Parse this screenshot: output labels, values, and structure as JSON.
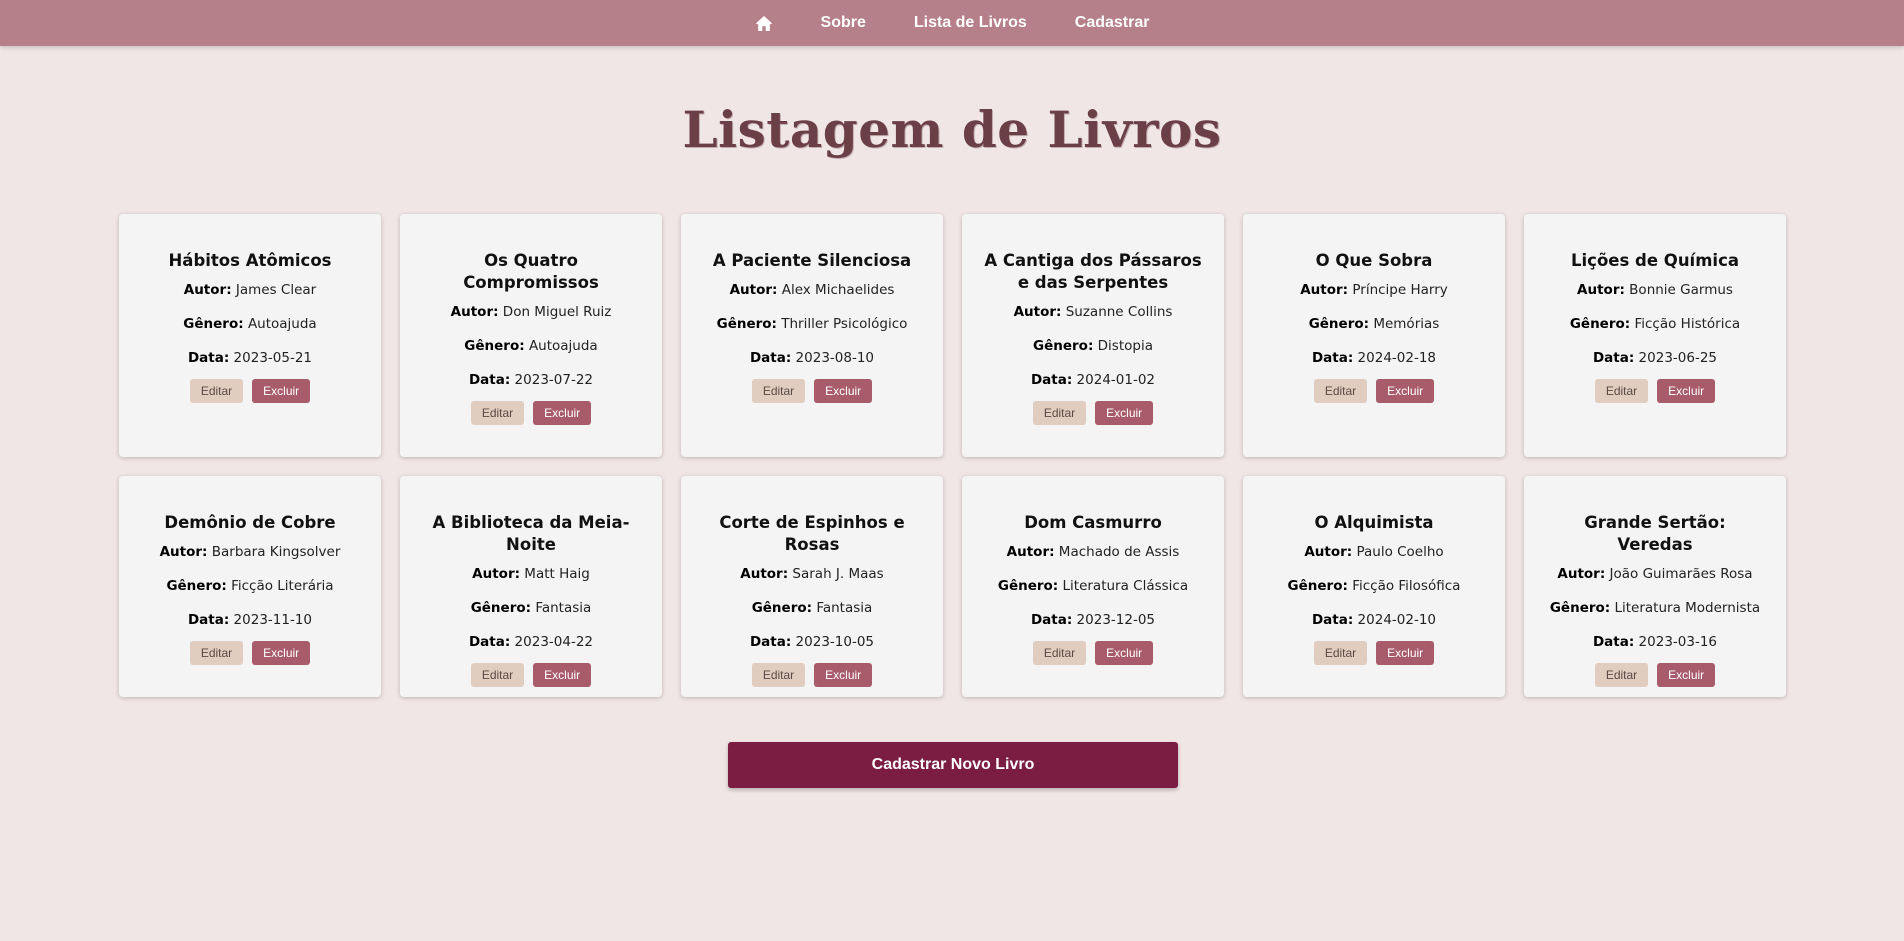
{
  "nav": {
    "home_icon": "home-icon",
    "items": [
      {
        "label": "Sobre"
      },
      {
        "label": "Lista de Livros"
      },
      {
        "label": "Cadastrar"
      }
    ]
  },
  "page": {
    "title": "Listagem de Livros",
    "new_book_button": "Cadastrar Novo Livro"
  },
  "labels": {
    "author": "Autor:",
    "genre": "Gênero:",
    "date": "Data:",
    "edit": "Editar",
    "delete": "Excluir"
  },
  "books": [
    {
      "title": "Hábitos Atômicos",
      "author": "James Clear",
      "genre": "Autoajuda",
      "date": "2023-05-21"
    },
    {
      "title": "Os Quatro Compromissos",
      "author": "Don Miguel Ruiz",
      "genre": "Autoajuda",
      "date": "2023-07-22"
    },
    {
      "title": "A Paciente Silenciosa",
      "author": "Alex Michaelides",
      "genre": "Thriller Psicológico",
      "date": "2023-08-10"
    },
    {
      "title": "A Cantiga dos Pássaros e das Serpentes",
      "author": "Suzanne Collins",
      "genre": "Distopia",
      "date": "2024-01-02"
    },
    {
      "title": "O Que Sobra",
      "author": "Príncipe Harry",
      "genre": "Memórias",
      "date": "2024-02-18"
    },
    {
      "title": "Lições de Química",
      "author": "Bonnie Garmus",
      "genre": "Ficção Histórica",
      "date": "2023-06-25"
    },
    {
      "title": "Demônio de Cobre",
      "author": "Barbara Kingsolver",
      "genre": "Ficção Literária",
      "date": "2023-11-10"
    },
    {
      "title": "A Biblioteca da Meia-Noite",
      "author": "Matt Haig",
      "genre": "Fantasia",
      "date": "2023-04-22"
    },
    {
      "title": "Corte de Espinhos e Rosas",
      "author": "Sarah J. Maas",
      "genre": "Fantasia",
      "date": "2023-10-05"
    },
    {
      "title": "Dom Casmurro",
      "author": "Machado de Assis",
      "genre": "Literatura Clássica",
      "date": "2023-12-05"
    },
    {
      "title": "O Alquimista",
      "author": "Paulo Coelho",
      "genre": "Ficção Filosófica",
      "date": "2024-02-10"
    },
    {
      "title": "Grande Sertão: Veredas",
      "author": "João Guimarães Rosa",
      "genre": "Literatura Modernista",
      "date": "2023-03-16"
    }
  ],
  "colors": {
    "navbar": "#b5808a",
    "background": "#f1e6e6",
    "title": "#6b3f46",
    "edit_button": "#e1cdbf",
    "delete_button": "#a85c6b",
    "primary_button": "#7b1c42"
  }
}
